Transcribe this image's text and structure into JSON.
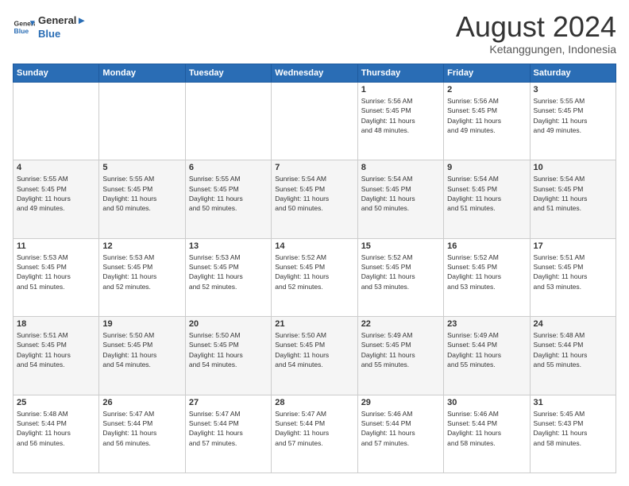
{
  "header": {
    "logo_line1": "General",
    "logo_line2": "Blue",
    "month_title": "August 2024",
    "location": "Ketanggungen, Indonesia"
  },
  "weekdays": [
    "Sunday",
    "Monday",
    "Tuesday",
    "Wednesday",
    "Thursday",
    "Friday",
    "Saturday"
  ],
  "weeks": [
    [
      {
        "day": "",
        "info": ""
      },
      {
        "day": "",
        "info": ""
      },
      {
        "day": "",
        "info": ""
      },
      {
        "day": "",
        "info": ""
      },
      {
        "day": "1",
        "info": "Sunrise: 5:56 AM\nSunset: 5:45 PM\nDaylight: 11 hours\nand 48 minutes."
      },
      {
        "day": "2",
        "info": "Sunrise: 5:56 AM\nSunset: 5:45 PM\nDaylight: 11 hours\nand 49 minutes."
      },
      {
        "day": "3",
        "info": "Sunrise: 5:55 AM\nSunset: 5:45 PM\nDaylight: 11 hours\nand 49 minutes."
      }
    ],
    [
      {
        "day": "4",
        "info": "Sunrise: 5:55 AM\nSunset: 5:45 PM\nDaylight: 11 hours\nand 49 minutes."
      },
      {
        "day": "5",
        "info": "Sunrise: 5:55 AM\nSunset: 5:45 PM\nDaylight: 11 hours\nand 50 minutes."
      },
      {
        "day": "6",
        "info": "Sunrise: 5:55 AM\nSunset: 5:45 PM\nDaylight: 11 hours\nand 50 minutes."
      },
      {
        "day": "7",
        "info": "Sunrise: 5:54 AM\nSunset: 5:45 PM\nDaylight: 11 hours\nand 50 minutes."
      },
      {
        "day": "8",
        "info": "Sunrise: 5:54 AM\nSunset: 5:45 PM\nDaylight: 11 hours\nand 50 minutes."
      },
      {
        "day": "9",
        "info": "Sunrise: 5:54 AM\nSunset: 5:45 PM\nDaylight: 11 hours\nand 51 minutes."
      },
      {
        "day": "10",
        "info": "Sunrise: 5:54 AM\nSunset: 5:45 PM\nDaylight: 11 hours\nand 51 minutes."
      }
    ],
    [
      {
        "day": "11",
        "info": "Sunrise: 5:53 AM\nSunset: 5:45 PM\nDaylight: 11 hours\nand 51 minutes."
      },
      {
        "day": "12",
        "info": "Sunrise: 5:53 AM\nSunset: 5:45 PM\nDaylight: 11 hours\nand 52 minutes."
      },
      {
        "day": "13",
        "info": "Sunrise: 5:53 AM\nSunset: 5:45 PM\nDaylight: 11 hours\nand 52 minutes."
      },
      {
        "day": "14",
        "info": "Sunrise: 5:52 AM\nSunset: 5:45 PM\nDaylight: 11 hours\nand 52 minutes."
      },
      {
        "day": "15",
        "info": "Sunrise: 5:52 AM\nSunset: 5:45 PM\nDaylight: 11 hours\nand 53 minutes."
      },
      {
        "day": "16",
        "info": "Sunrise: 5:52 AM\nSunset: 5:45 PM\nDaylight: 11 hours\nand 53 minutes."
      },
      {
        "day": "17",
        "info": "Sunrise: 5:51 AM\nSunset: 5:45 PM\nDaylight: 11 hours\nand 53 minutes."
      }
    ],
    [
      {
        "day": "18",
        "info": "Sunrise: 5:51 AM\nSunset: 5:45 PM\nDaylight: 11 hours\nand 54 minutes."
      },
      {
        "day": "19",
        "info": "Sunrise: 5:50 AM\nSunset: 5:45 PM\nDaylight: 11 hours\nand 54 minutes."
      },
      {
        "day": "20",
        "info": "Sunrise: 5:50 AM\nSunset: 5:45 PM\nDaylight: 11 hours\nand 54 minutes."
      },
      {
        "day": "21",
        "info": "Sunrise: 5:50 AM\nSunset: 5:45 PM\nDaylight: 11 hours\nand 54 minutes."
      },
      {
        "day": "22",
        "info": "Sunrise: 5:49 AM\nSunset: 5:45 PM\nDaylight: 11 hours\nand 55 minutes."
      },
      {
        "day": "23",
        "info": "Sunrise: 5:49 AM\nSunset: 5:44 PM\nDaylight: 11 hours\nand 55 minutes."
      },
      {
        "day": "24",
        "info": "Sunrise: 5:48 AM\nSunset: 5:44 PM\nDaylight: 11 hours\nand 55 minutes."
      }
    ],
    [
      {
        "day": "25",
        "info": "Sunrise: 5:48 AM\nSunset: 5:44 PM\nDaylight: 11 hours\nand 56 minutes."
      },
      {
        "day": "26",
        "info": "Sunrise: 5:47 AM\nSunset: 5:44 PM\nDaylight: 11 hours\nand 56 minutes."
      },
      {
        "day": "27",
        "info": "Sunrise: 5:47 AM\nSunset: 5:44 PM\nDaylight: 11 hours\nand 57 minutes."
      },
      {
        "day": "28",
        "info": "Sunrise: 5:47 AM\nSunset: 5:44 PM\nDaylight: 11 hours\nand 57 minutes."
      },
      {
        "day": "29",
        "info": "Sunrise: 5:46 AM\nSunset: 5:44 PM\nDaylight: 11 hours\nand 57 minutes."
      },
      {
        "day": "30",
        "info": "Sunrise: 5:46 AM\nSunset: 5:44 PM\nDaylight: 11 hours\nand 58 minutes."
      },
      {
        "day": "31",
        "info": "Sunrise: 5:45 AM\nSunset: 5:43 PM\nDaylight: 11 hours\nand 58 minutes."
      }
    ]
  ],
  "colors": {
    "header_bg": "#2a6db5",
    "header_text": "#ffffff",
    "row_even": "#f5f5f5",
    "row_odd": "#ffffff"
  }
}
